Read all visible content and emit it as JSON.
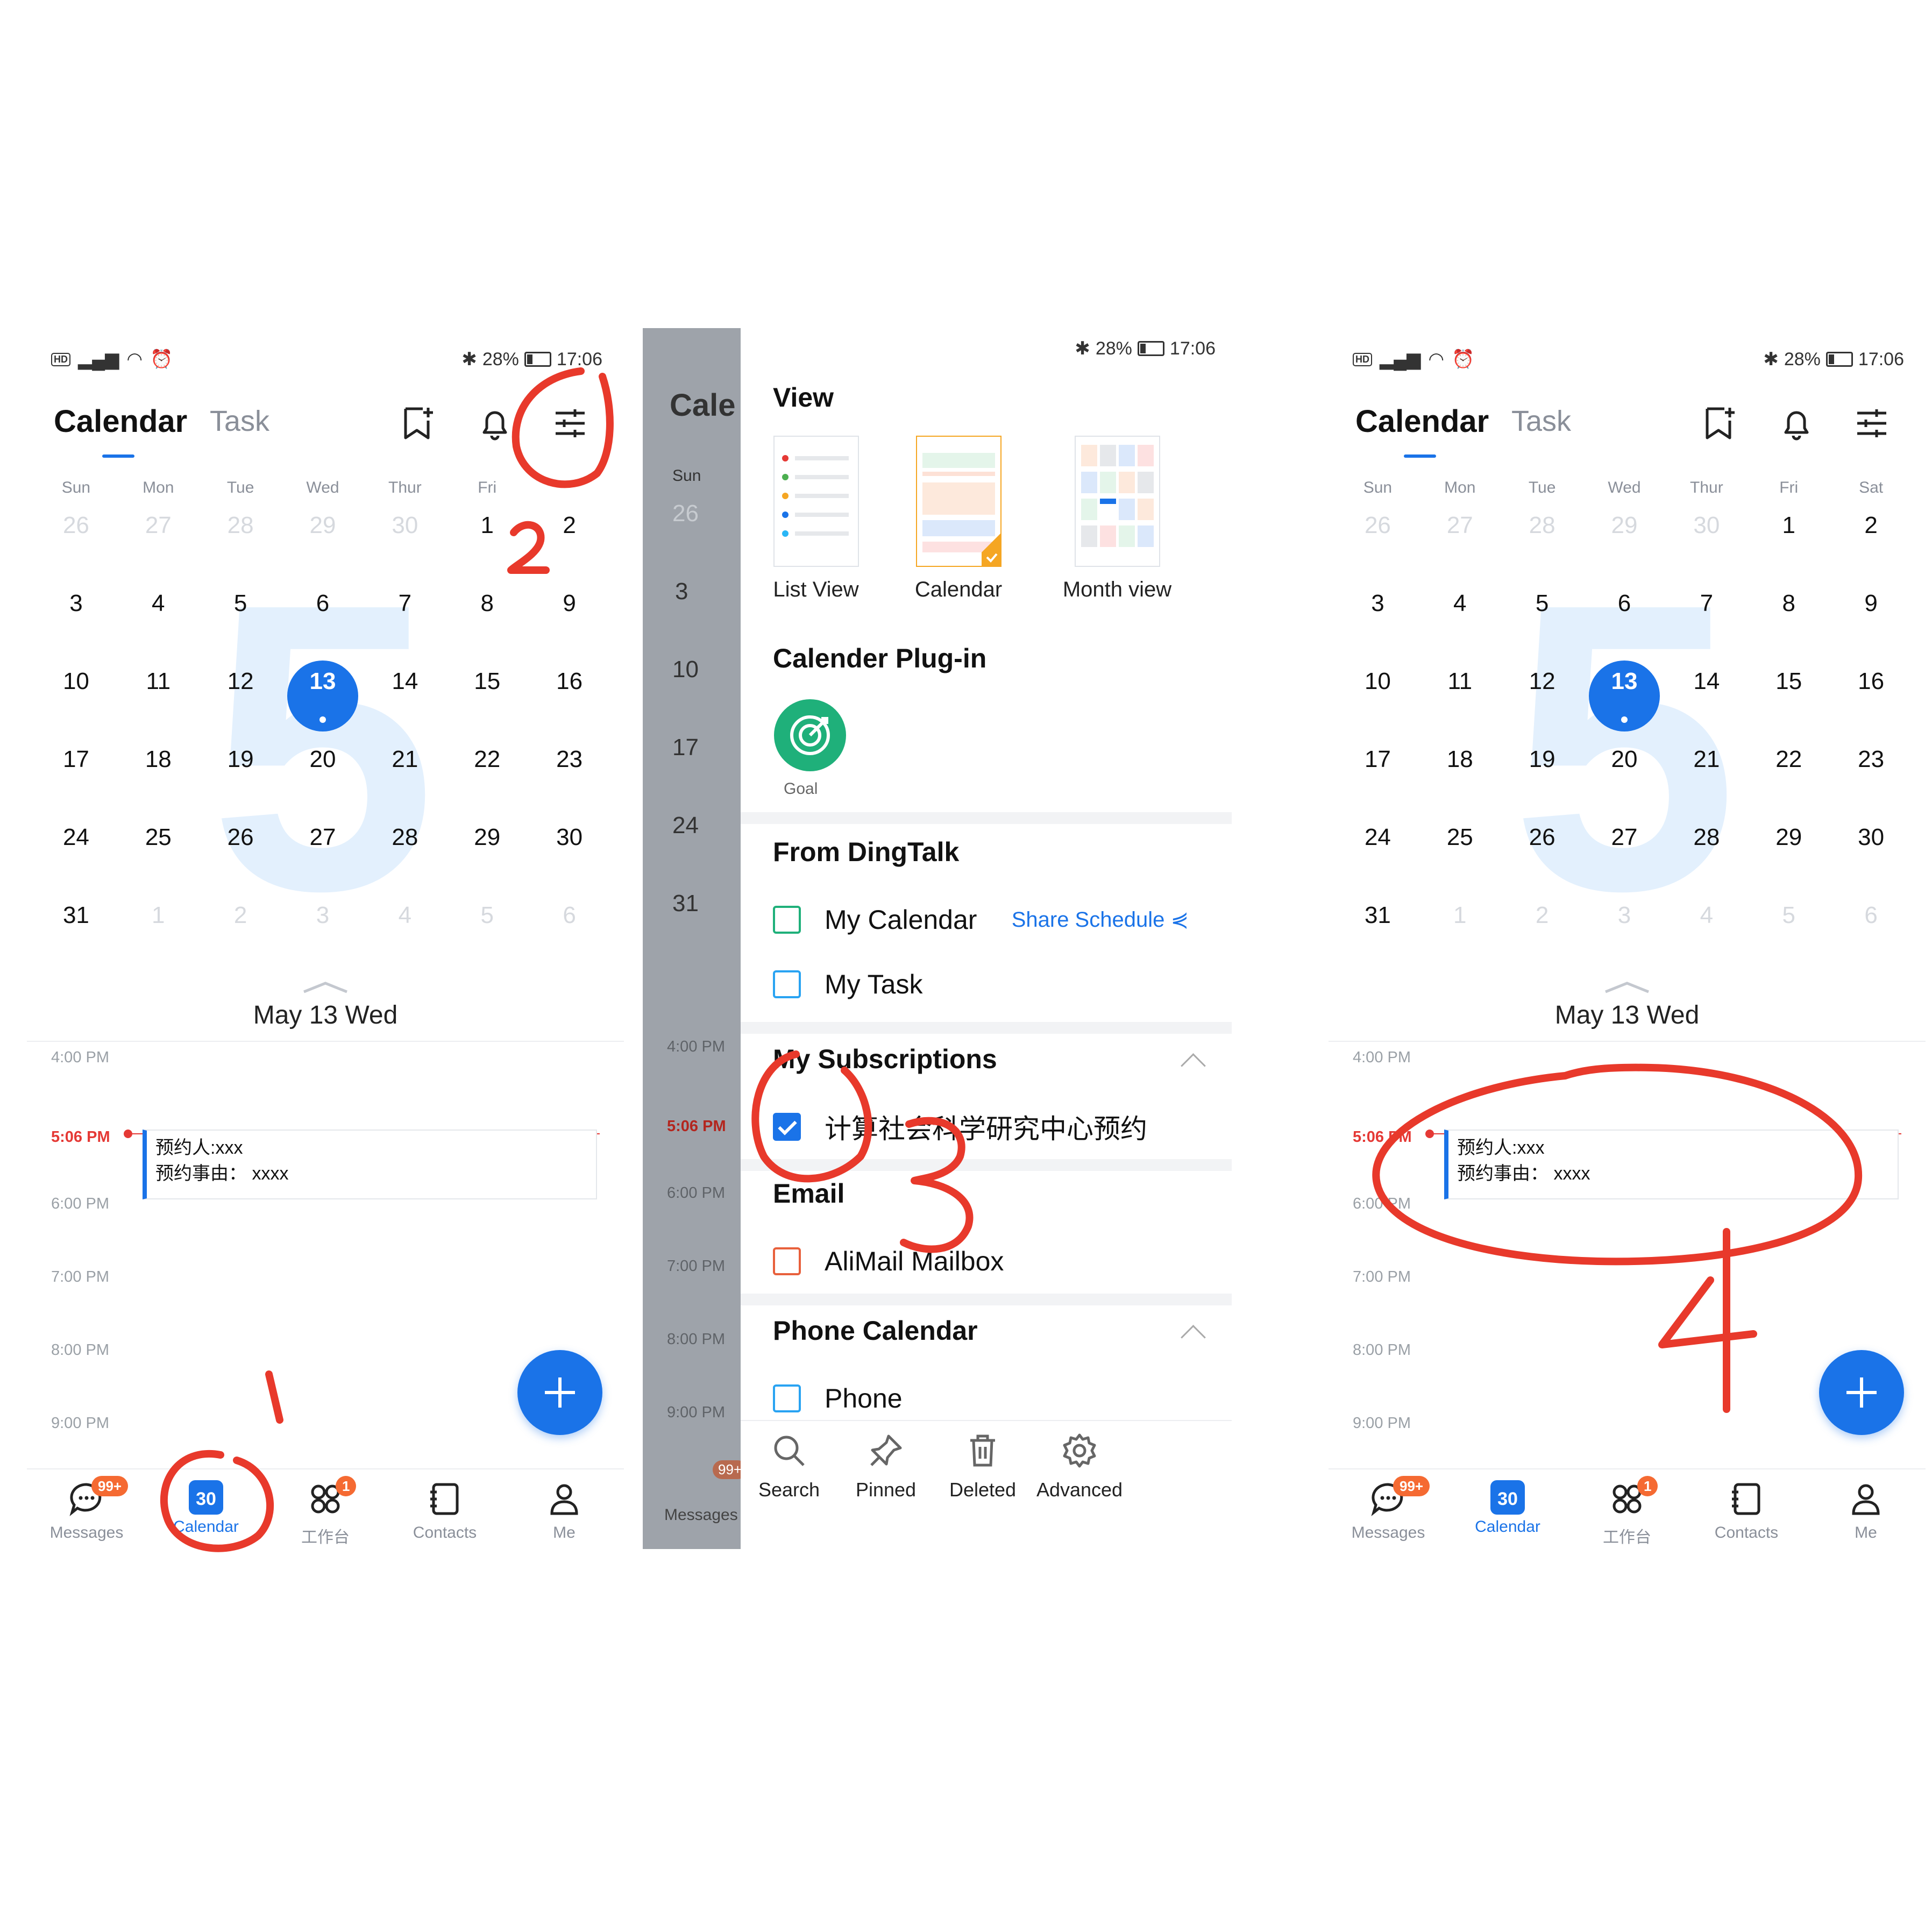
{
  "status": {
    "left_hd": "HD",
    "right_battery": "28%",
    "right_time": "17:06"
  },
  "header": {
    "title": "Calendar",
    "task_tab": "Task"
  },
  "weekdays": [
    "Sun",
    "Mon",
    "Tue",
    "Wed",
    "Thur",
    "Fri",
    "Sat"
  ],
  "weekdays_left_visible": [
    "Sun",
    "Mon",
    "Tue",
    "Wed",
    "Thur",
    "Fri",
    ""
  ],
  "month_number": "5",
  "weeks": [
    [
      "26",
      "27",
      "28",
      "29",
      "30",
      "1",
      "2"
    ],
    [
      "3",
      "4",
      "5",
      "6",
      "7",
      "8",
      "9"
    ],
    [
      "10",
      "11",
      "12",
      "13",
      "14",
      "15",
      "16"
    ],
    [
      "17",
      "18",
      "19",
      "20",
      "21",
      "22",
      "23"
    ],
    [
      "24",
      "25",
      "26",
      "27",
      "28",
      "29",
      "30"
    ],
    [
      "31",
      "1",
      "2",
      "3",
      "4",
      "5",
      "6"
    ]
  ],
  "selected_date": "May 13 Wed",
  "timeline": {
    "labels": [
      "4:00 PM",
      "5:06 PM",
      "6:00 PM",
      "7:00 PM",
      "8:00 PM",
      "9:00 PM"
    ],
    "event_line1": "预约人:xxx",
    "event_line2": "预约事由： xxxx"
  },
  "nav": {
    "messages": "Messages",
    "messages_badge": "99+",
    "calendar": "Calendar",
    "calendar_icon_num": "30",
    "workbench": "工作台",
    "workbench_badge": "1",
    "contacts": "Contacts",
    "me": "Me"
  },
  "drawer": {
    "ghost_title": "Cale",
    "ghost_sun": "Sun",
    "ghost_days": [
      "26",
      "3",
      "10",
      "17",
      "24",
      "31"
    ],
    "ghost_times": [
      "4:00 PM",
      "5:06 PM",
      "6:00 PM",
      "7:00 PM",
      "8:00 PM",
      "9:00 PM"
    ],
    "ghost_messages": "Messages",
    "ghost_badge": "99+",
    "view_title": "View",
    "view_options": [
      "List View",
      "Calendar",
      "Month view"
    ],
    "plugin_title": "Calender Plug-in",
    "goal_label": "Goal",
    "from_dingtalk": "From DingTalk",
    "my_calendar": "My Calendar",
    "share_schedule": "Share Schedule",
    "my_task": "My Task",
    "subscriptions_title": "My Subscriptions",
    "subscription_item": "计算社会科学研究中心预约",
    "email_title": "Email",
    "alimail": "AliMail Mailbox",
    "phone_cal_title": "Phone Calendar",
    "phone": "Phone",
    "tools": [
      "Search",
      "Pinned",
      "Deleted",
      "Advanced"
    ]
  },
  "colors": {
    "accent": "#1a73e8",
    "now_red": "#e53935",
    "badge_orange": "#f56a32",
    "goal_green": "#1fb07a",
    "annotation_red": "#e8392b"
  },
  "annotations": [
    "1",
    "2",
    "3",
    "4"
  ]
}
